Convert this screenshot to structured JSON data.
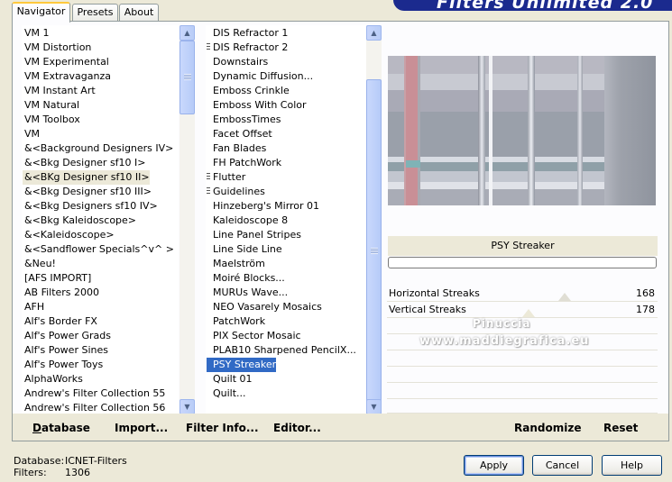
{
  "tabs": [
    {
      "label": "Navigator",
      "active": true
    },
    {
      "label": "Presets",
      "active": false
    },
    {
      "label": "About",
      "active": false
    }
  ],
  "banner_text": "Filters Unlimited 2.0",
  "categories": [
    {
      "label": "VM 1"
    },
    {
      "label": "VM Distortion"
    },
    {
      "label": "VM Experimental"
    },
    {
      "label": "VM Extravaganza"
    },
    {
      "label": "VM Instant Art"
    },
    {
      "label": "VM Natural"
    },
    {
      "label": "VM Toolbox"
    },
    {
      "label": "VM"
    },
    {
      "label": "&<Background Designers IV>"
    },
    {
      "label": "&<Bkg Designer sf10 I>"
    },
    {
      "label": "&<BKg Designer sf10 II>",
      "selected": true
    },
    {
      "label": "&<Bkg Designer sf10 III>"
    },
    {
      "label": "&<Bkg Designers sf10 IV>"
    },
    {
      "label": "&<Bkg Kaleidoscope>"
    },
    {
      "label": "&<Kaleidoscope>"
    },
    {
      "label": "&<Sandflower Specials^v^ >"
    },
    {
      "label": "&Neu!"
    },
    {
      "label": "[AFS IMPORT]"
    },
    {
      "label": "AB Filters 2000"
    },
    {
      "label": "AFH"
    },
    {
      "label": "Alf's Border FX"
    },
    {
      "label": "Alf's Power Grads"
    },
    {
      "label": "Alf's Power Sines"
    },
    {
      "label": "Alf's Power Toys"
    },
    {
      "label": "AlphaWorks"
    },
    {
      "label": "Andrew's Filter Collection 55"
    },
    {
      "label": "Andrew's Filter Collection 56"
    }
  ],
  "filters": [
    {
      "label": "DIS Refractor 1"
    },
    {
      "label": "DIS Refractor 2",
      "grip": true
    },
    {
      "label": "Downstairs"
    },
    {
      "label": "Dynamic Diffusion..."
    },
    {
      "label": "Emboss Crinkle"
    },
    {
      "label": "Emboss With Color"
    },
    {
      "label": "EmbossTimes"
    },
    {
      "label": "Facet Offset"
    },
    {
      "label": "Fan Blades"
    },
    {
      "label": "FH PatchWork"
    },
    {
      "label": "Flutter",
      "grip": true
    },
    {
      "label": "Guidelines",
      "grip": true
    },
    {
      "label": "Hinzeberg's Mirror 01"
    },
    {
      "label": "Kaleidoscope 8"
    },
    {
      "label": "Line Panel Stripes"
    },
    {
      "label": "Line Side Line"
    },
    {
      "label": "Maelström"
    },
    {
      "label": "Moiré Blocks..."
    },
    {
      "label": "MURUs Wave..."
    },
    {
      "label": "NEO Vasarely Mosaics"
    },
    {
      "label": "PatchWork"
    },
    {
      "label": "PIX Sector Mosaic"
    },
    {
      "label": "PLAB10 Sharpened PencilX..."
    },
    {
      "label": "PSY Streaker",
      "selected": true
    },
    {
      "label": "Quilt 01"
    },
    {
      "label": "Quilt..."
    }
  ],
  "selected_filter_name": "PSY Streaker",
  "parameters": [
    {
      "label": "Horizontal Streaks",
      "value": "168"
    },
    {
      "label": "Vertical Streaks",
      "value": "178"
    }
  ],
  "watermark": {
    "line1": "Pinuccia",
    "line2": "www.maddiegrafica.eu"
  },
  "actions": {
    "database": "Database",
    "import": "Import...",
    "filter_info": "Filter Info...",
    "editor": "Editor...",
    "randomize": "Randomize",
    "reset": "Reset"
  },
  "footer": {
    "database_label": "Database:",
    "database_value": "ICNET-Filters",
    "filters_label": "Filters:",
    "filters_value": "1306"
  },
  "buttons": {
    "apply": "Apply",
    "cancel": "Cancel",
    "help": "Help"
  },
  "colors": {
    "selection": "#316ac5",
    "window_bg": "#ece9d8",
    "banner": "#1b2a8e"
  }
}
